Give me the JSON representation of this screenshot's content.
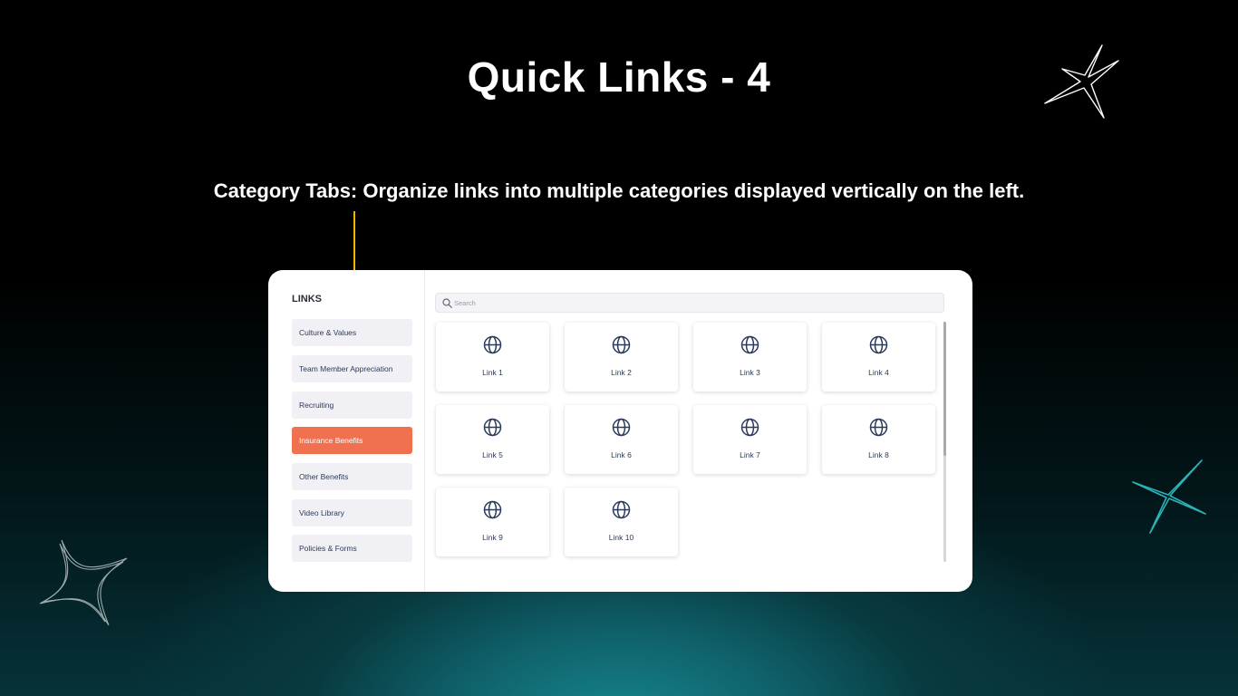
{
  "slide": {
    "title": "Quick Links - 4",
    "description": "Category Tabs: Organize links into multiple categories displayed vertically on the left."
  },
  "widget": {
    "heading": "LINKS",
    "search": {
      "placeholder": "Search",
      "value": ""
    },
    "categories": [
      {
        "label": "Culture & Values",
        "active": false
      },
      {
        "label": "Team Member Appreciation",
        "active": false
      },
      {
        "label": "Recruiting",
        "active": false
      },
      {
        "label": "Insurance Benefits",
        "active": true
      },
      {
        "label": "Other Benefits",
        "active": false
      },
      {
        "label": "Video Library",
        "active": false
      },
      {
        "label": "Policies & Forms",
        "active": false
      }
    ],
    "links": [
      {
        "label": "Link 1",
        "icon": "globe-icon"
      },
      {
        "label": "Link 2",
        "icon": "globe-icon"
      },
      {
        "label": "Link 3",
        "icon": "globe-icon"
      },
      {
        "label": "Link 4",
        "icon": "globe-icon"
      },
      {
        "label": "Link 5",
        "icon": "globe-icon"
      },
      {
        "label": "Link 6",
        "icon": "globe-icon"
      },
      {
        "label": "Link 7",
        "icon": "globe-icon"
      },
      {
        "label": "Link 8",
        "icon": "globe-icon"
      },
      {
        "label": "Link 9",
        "icon": "globe-icon"
      },
      {
        "label": "Link 10",
        "icon": "globe-icon"
      }
    ]
  },
  "colors": {
    "accent": "#ef7150",
    "pointer": "#f5b400",
    "text_dark": "#2b3a5c",
    "sparkle_teal": "#2bb3b8"
  }
}
